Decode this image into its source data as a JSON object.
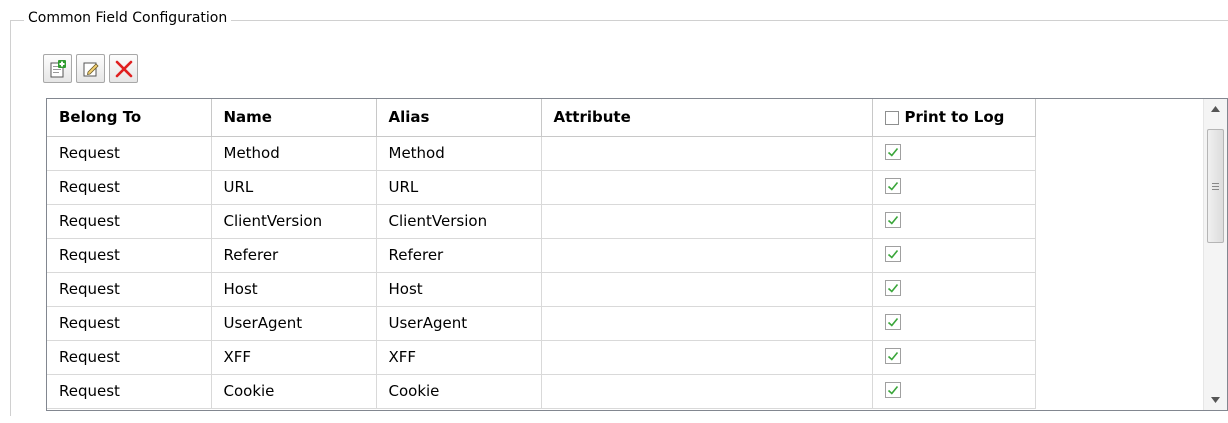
{
  "group": {
    "title": "Common Field Configuration"
  },
  "toolbar": {
    "buttons": [
      {
        "icon": "add-icon",
        "color": "#2e9b2e"
      },
      {
        "icon": "edit-icon",
        "color": "#3a6ea5"
      },
      {
        "icon": "delete-icon",
        "color": "#e02020"
      }
    ]
  },
  "table": {
    "columns": [
      "Belong To",
      "Name",
      "Alias",
      "Attribute",
      "Print to Log"
    ],
    "rows": [
      {
        "belong_to": "Request",
        "name": "Method",
        "alias": "Method",
        "attribute": "",
        "print_to_log": true
      },
      {
        "belong_to": "Request",
        "name": "URL",
        "alias": "URL",
        "attribute": "",
        "print_to_log": true
      },
      {
        "belong_to": "Request",
        "name": "ClientVersion",
        "alias": "ClientVersion",
        "attribute": "",
        "print_to_log": true
      },
      {
        "belong_to": "Request",
        "name": "Referer",
        "alias": "Referer",
        "attribute": "",
        "print_to_log": true
      },
      {
        "belong_to": "Request",
        "name": "Host",
        "alias": "Host",
        "attribute": "",
        "print_to_log": true
      },
      {
        "belong_to": "Request",
        "name": "UserAgent",
        "alias": "UserAgent",
        "attribute": "",
        "print_to_log": true
      },
      {
        "belong_to": "Request",
        "name": "XFF",
        "alias": "XFF",
        "attribute": "",
        "print_to_log": true
      },
      {
        "belong_to": "Request",
        "name": "Cookie",
        "alias": "Cookie",
        "attribute": "",
        "print_to_log": true
      }
    ],
    "header_checkbox_checked": false,
    "check_color": "#3aa63a"
  }
}
